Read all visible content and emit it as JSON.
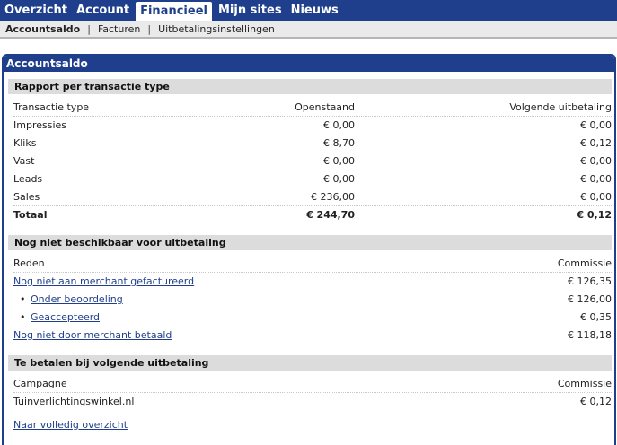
{
  "topnav": {
    "tabs": [
      "Overzicht",
      "Account",
      "Financieel",
      "Mijn sites",
      "Nieuws"
    ],
    "active": "Financieel"
  },
  "subnav": {
    "items": [
      "Accountsaldo",
      "Facturen",
      "Uitbetalingsinstellingen"
    ],
    "separator": "|"
  },
  "panel": {
    "title": "Accountsaldo"
  },
  "rapport": {
    "title": "Rapport per transactie type",
    "headers": [
      "Transactie type",
      "Openstaand",
      "Volgende uitbetaling"
    ],
    "rows": [
      [
        "Impressies",
        "€ 0,00",
        "€ 0,00"
      ],
      [
        "Kliks",
        "€ 8,70",
        "€ 0,12"
      ],
      [
        "Vast",
        "€ 0,00",
        "€ 0,00"
      ],
      [
        "Leads",
        "€ 0,00",
        "€ 0,00"
      ],
      [
        "Sales",
        "€ 236,00",
        "€ 0,00"
      ]
    ],
    "total": [
      "Totaal",
      "€ 244,70",
      "€ 0,12"
    ]
  },
  "niet_beschikbaar": {
    "title": "Nog niet beschikbaar voor uitbetaling",
    "headers": [
      "Reden",
      "Commissie"
    ],
    "rows": [
      {
        "label": "Nog niet aan merchant gefactureerd",
        "value": "€ 126,35"
      },
      {
        "label": "Onder beoordeling",
        "value": "€ 126,00"
      },
      {
        "label": "Geaccepteerd",
        "value": "€ 0,35"
      },
      {
        "label": "Nog niet door merchant betaald",
        "value": "€ 118,18"
      }
    ],
    "bullet": "•"
  },
  "te_betalen": {
    "title": "Te betalen bij volgende uitbetaling",
    "headers": [
      "Campagne",
      "Commissie"
    ],
    "rows": [
      {
        "label": "Tuinverlichtingswinkel.nl",
        "value": "€ 0,12"
      }
    ],
    "link": "Naar volledig overzicht"
  }
}
